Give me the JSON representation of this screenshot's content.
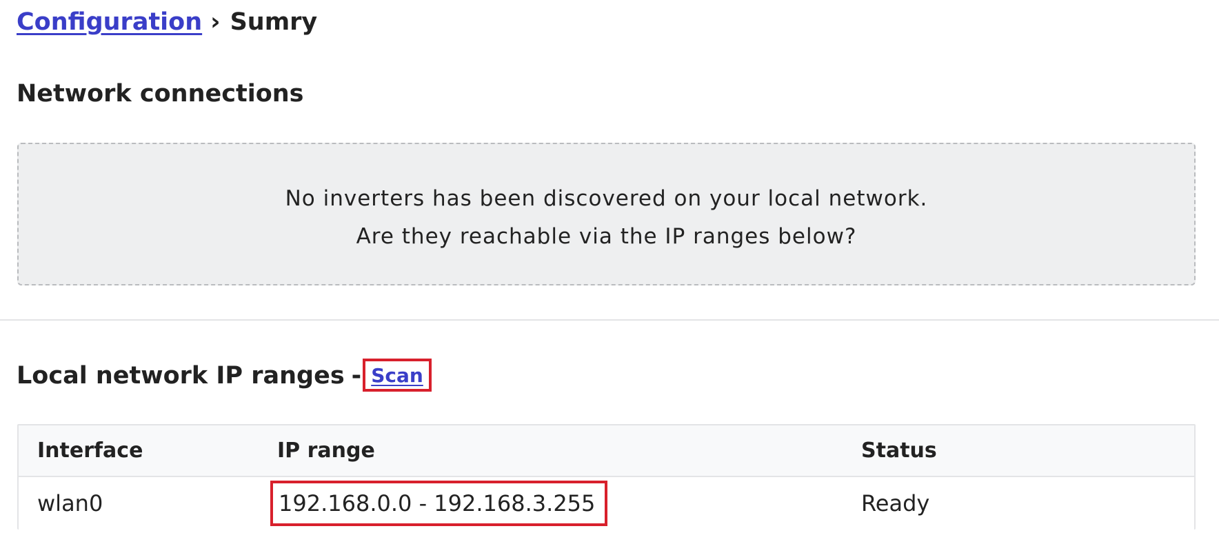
{
  "breadcrumb": {
    "parent": "Configuration",
    "separator": "›",
    "current": "Sumry"
  },
  "network_connections": {
    "title": "Network connections",
    "notice_line1": "No inverters has been discovered on your local network.",
    "notice_line2": "Are they reachable via the IP ranges below?"
  },
  "ip_ranges": {
    "title": "Local network IP ranges",
    "title_separator": "-",
    "scan_label": "Scan",
    "columns": [
      "Interface",
      "IP range",
      "Status"
    ],
    "rows": [
      {
        "interface": "wlan0",
        "ip_range": "192.168.0.0 - 192.168.3.255",
        "status": "Ready"
      }
    ]
  },
  "colors": {
    "link": "#3a3ec8",
    "status_ready": "#4a7fe0",
    "highlight_box": "#d8202c",
    "notice_bg": "#eeeff0"
  }
}
